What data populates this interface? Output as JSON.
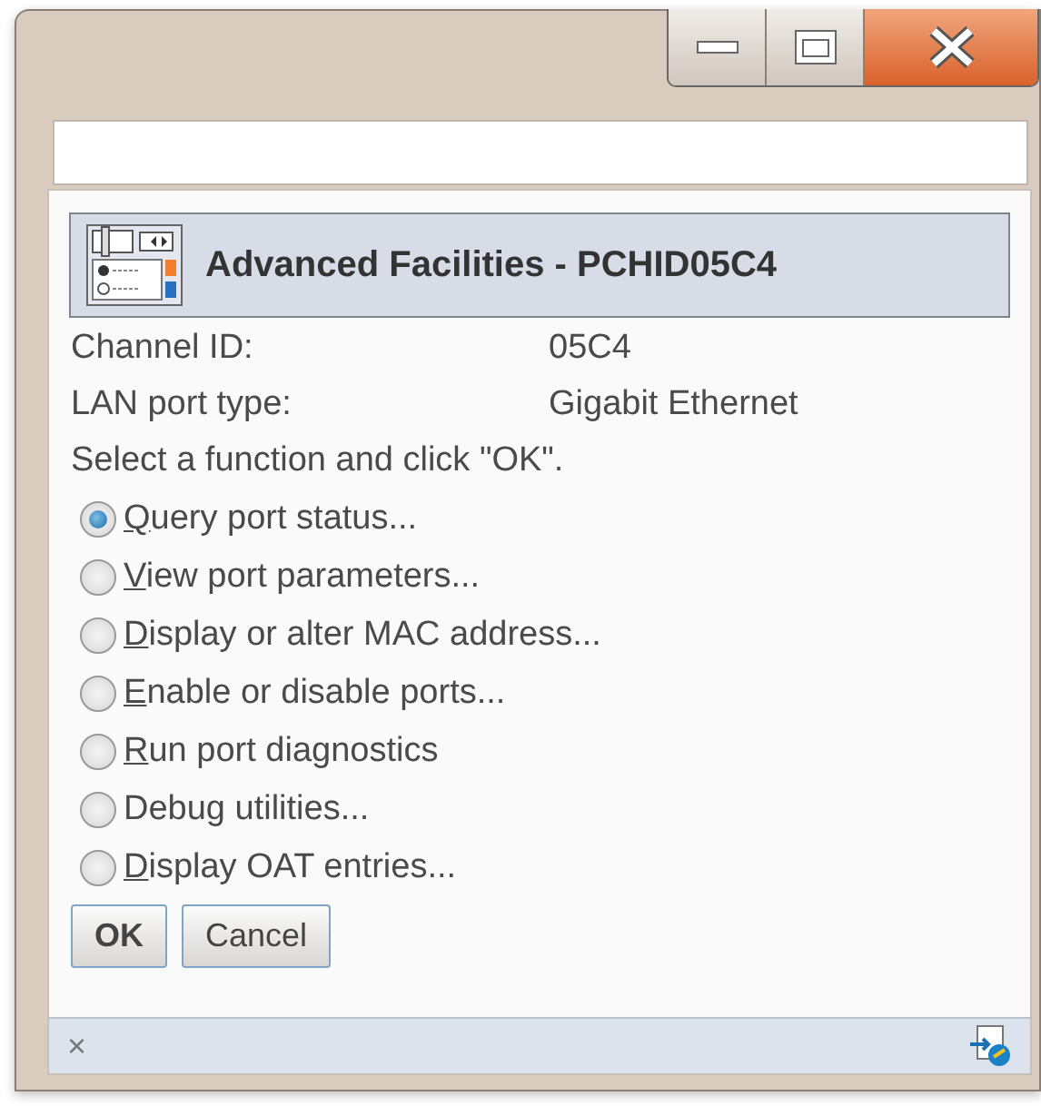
{
  "dialog": {
    "title": "Advanced Facilities - PCHID05C4"
  },
  "fields": [
    {
      "label": "Channel ID:",
      "value": "05C4"
    },
    {
      "label": "LAN port type:",
      "value": "Gigabit Ethernet"
    }
  ],
  "instruction": "Select a function and click \"OK\".",
  "options": [
    {
      "label": "Query port status...",
      "selected": true,
      "mnemonic": true
    },
    {
      "label": "View port parameters...",
      "selected": false,
      "mnemonic": true
    },
    {
      "label": "Display or alter MAC address...",
      "selected": false,
      "mnemonic": true
    },
    {
      "label": "Enable or disable ports...",
      "selected": false,
      "mnemonic": true
    },
    {
      "label": "Run port diagnostics",
      "selected": false,
      "mnemonic": true
    },
    {
      "label": "Debug utilities...",
      "selected": false,
      "mnemonic": false
    },
    {
      "label": "Display OAT entries...",
      "selected": false,
      "mnemonic": true
    }
  ],
  "buttons": [
    {
      "label": "OK",
      "default": true
    },
    {
      "label": "Cancel",
      "default": false
    }
  ],
  "status_bar": {
    "close": "×"
  }
}
